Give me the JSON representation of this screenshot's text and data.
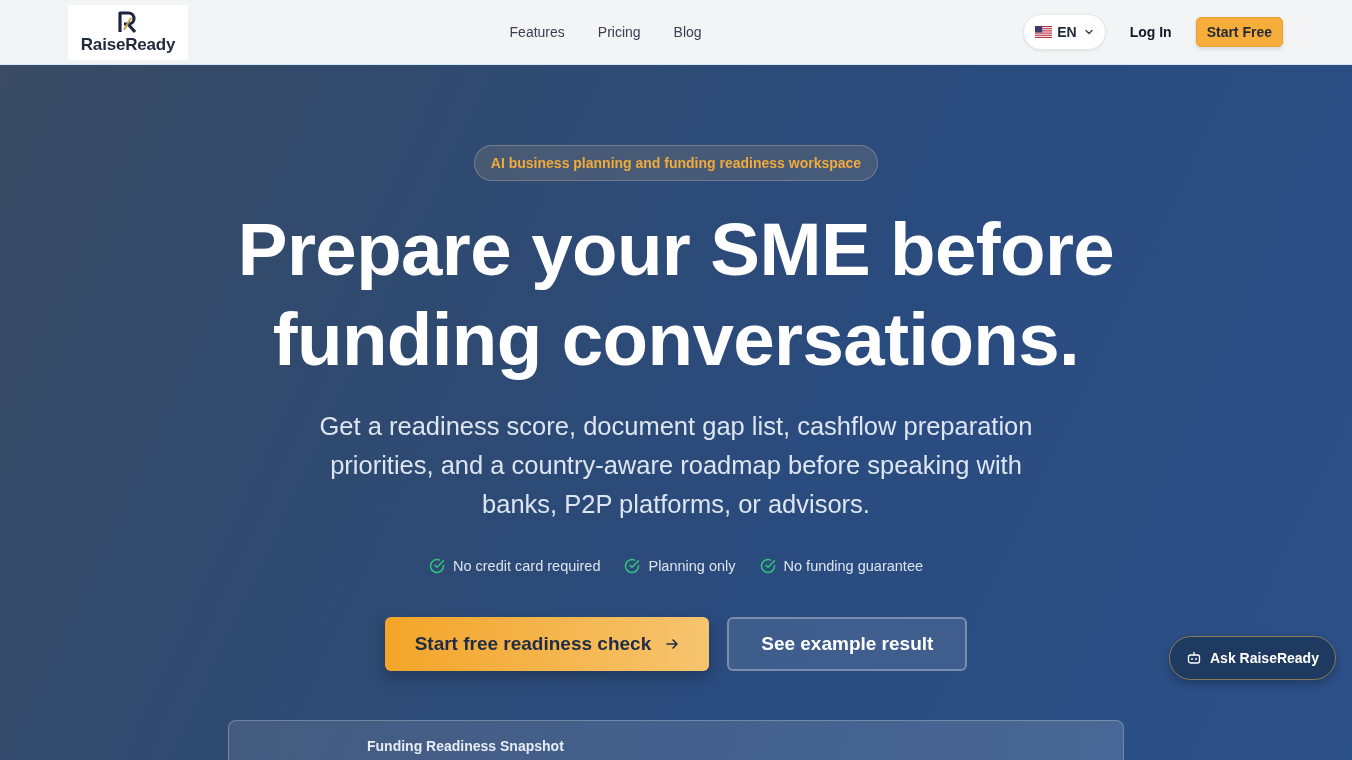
{
  "header": {
    "logo": {
      "text": "RaiseReady"
    },
    "nav": [
      {
        "label": "Features"
      },
      {
        "label": "Pricing"
      },
      {
        "label": "Blog"
      }
    ],
    "language": {
      "label": "EN"
    },
    "login": "Log In",
    "cta": "Start Free"
  },
  "hero": {
    "badge": "AI business planning and funding readiness workspace",
    "headline": "Prepare your SME before funding conversations.",
    "subtitle": "Get a readiness score, document gap list, cashflow preparation priorities, and a country-aware roadmap before speaking with banks, P2P platforms, or advisors.",
    "checks": [
      "No credit card required",
      "Planning only",
      "No funding guarantee"
    ],
    "buttons": [
      {
        "label": "Start free readiness check",
        "kind": "primary"
      },
      {
        "label": "See example result",
        "kind": "secondary"
      }
    ],
    "snapshot": {
      "title": "Funding Readiness Snapshot"
    }
  },
  "chat": {
    "label": "Ask RaiseReady"
  }
}
